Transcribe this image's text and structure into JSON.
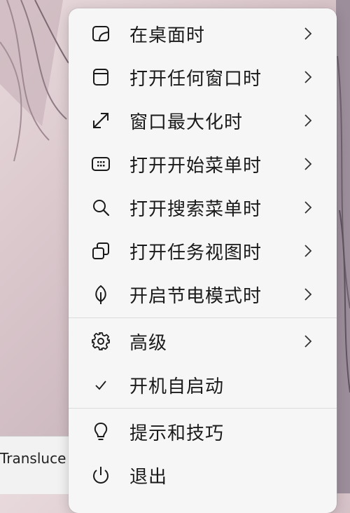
{
  "background": {
    "partial_label": "Transluce"
  },
  "menu": {
    "groups": [
      [
        {
          "label": "在桌面时",
          "icon": "desktop-icon",
          "has_submenu": true
        },
        {
          "label": "打开任何窗口时",
          "icon": "window-icon",
          "has_submenu": true
        },
        {
          "label": "窗口最大化时",
          "icon": "maximize-icon",
          "has_submenu": true
        },
        {
          "label": "打开开始菜单时",
          "icon": "start-menu-icon",
          "has_submenu": true
        },
        {
          "label": "打开搜索菜单时",
          "icon": "search-icon",
          "has_submenu": true
        },
        {
          "label": "打开任务视图时",
          "icon": "task-view-icon",
          "has_submenu": true
        },
        {
          "label": "开启节电模式时",
          "icon": "leaf-icon",
          "has_submenu": true
        }
      ],
      [
        {
          "label": "高级",
          "icon": "gear-icon",
          "has_submenu": true
        },
        {
          "label": "开机自启动",
          "icon": "checkmark-icon",
          "has_submenu": false,
          "checked": true
        }
      ],
      [
        {
          "label": "提示和技巧",
          "icon": "lightbulb-icon",
          "has_submenu": false
        },
        {
          "label": "退出",
          "icon": "power-icon",
          "has_submenu": false
        }
      ]
    ]
  },
  "colors": {
    "menu_bg": "#f7f6f7",
    "text": "#1a1a1a",
    "divider": "#dcdcdc"
  }
}
